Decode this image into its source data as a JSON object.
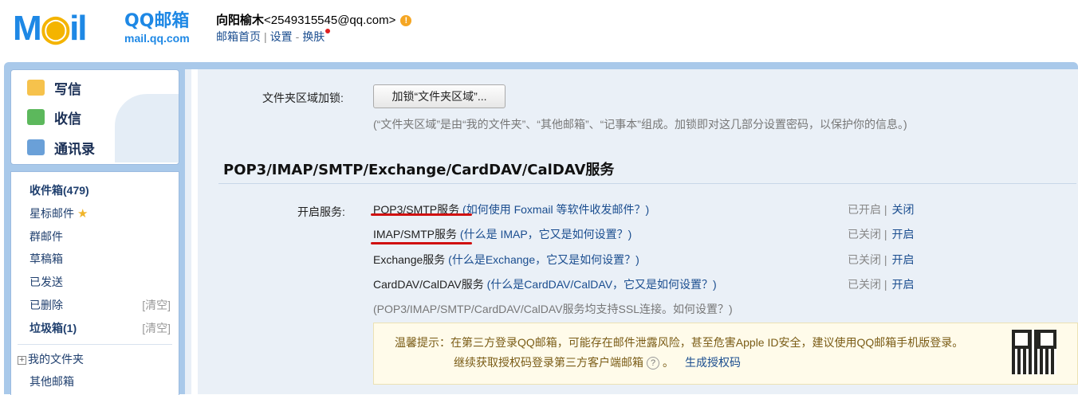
{
  "header": {
    "logo_text": "Mail",
    "logo_cn": "QQ邮箱",
    "logo_domain": "mail.qq.com",
    "user_name": "向阳榆木",
    "user_email": "<2549315545@qq.com>",
    "links": [
      "邮箱首页",
      "设置",
      "换肤"
    ]
  },
  "sidebar": {
    "actions": [
      "写信",
      "收信",
      "通讯录"
    ],
    "folders": [
      {
        "label": "收件箱(479)",
        "bold": true
      },
      {
        "label": "星标邮件",
        "star": true
      },
      {
        "label": "群邮件"
      },
      {
        "label": "草稿箱"
      },
      {
        "label": "已发送"
      },
      {
        "label": "已删除",
        "action": "[清空]"
      },
      {
        "label": "垃圾箱(1)",
        "bold": true,
        "action": "[清空]"
      }
    ],
    "my_folders": "我的文件夹",
    "other_mail": "其他邮箱"
  },
  "main": {
    "lock_label": "文件夹区域加锁:",
    "lock_button": "加锁“文件夹区域”...",
    "lock_note": "(“文件夹区域”是由“我的文件夹”、“其他邮箱”、“记事本”组成。加锁即对这几部分设置密码，以保护你的信息。)",
    "section_title": "POP3/IMAP/SMTP/Exchange/CardDAV/CalDAV服务",
    "service_label": "开启服务:",
    "services": [
      {
        "name": "POP3/SMTP服务",
        "help": "(如何使用 Foxmail 等软件收发邮件？)",
        "state": "已开启 |",
        "action": "关闭"
      },
      {
        "name": "IMAP/SMTP服务",
        "help": "(什么是 IMAP，它又是如何设置？)",
        "state": "已关闭 |",
        "action": "开启"
      },
      {
        "name": "Exchange服务",
        "help": "(什么是Exchange，它又是如何设置？)",
        "state": "已关闭 |",
        "action": "开启"
      },
      {
        "name": "CardDAV/CalDAV服务",
        "help": "(什么是CardDAV/CalDAV，它又是如何设置？)",
        "state": "已关闭 |",
        "action": "开启"
      }
    ],
    "ssl_note": "(POP3/IMAP/SMTP/CardDAV/CalDAV服务均支持SSL连接。如何设置？)",
    "tip_line1": "温馨提示：在第三方登录QQ邮箱，可能存在邮件泄露风险，甚至危害Apple ID安全，建议使用QQ邮箱手机版登录。",
    "tip_line2": "继续获取授权码登录第三方客户端邮箱",
    "tip_help": "?",
    "tip_link": "生成授权码"
  }
}
